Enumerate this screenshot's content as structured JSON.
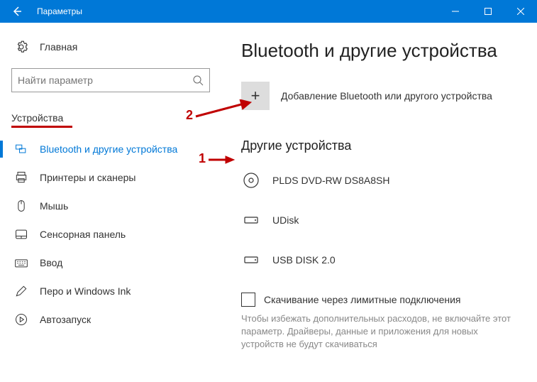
{
  "titlebar": {
    "title": "Параметры"
  },
  "sidebar": {
    "home_label": "Главная",
    "search_placeholder": "Найти параметр",
    "section": "Устройства",
    "items": [
      {
        "label": "Bluetooth и другие устройства"
      },
      {
        "label": "Принтеры и сканеры"
      },
      {
        "label": "Мышь"
      },
      {
        "label": "Сенсорная панель"
      },
      {
        "label": "Ввод"
      },
      {
        "label": "Перо и Windows Ink"
      },
      {
        "label": "Автозапуск"
      }
    ]
  },
  "main": {
    "title": "Bluetooth и другие устройства",
    "add_label": "Добавление Bluetooth или другого устройства",
    "other_devices": "Другие устройства",
    "devices": [
      {
        "label": "PLDS DVD-RW DS8A8SH"
      },
      {
        "label": "UDisk"
      },
      {
        "label": "USB DISK 2.0"
      }
    ],
    "metered_label": "Скачивание через лимитные подключения",
    "metered_hint": "Чтобы избежать дополнительных расходов, не включайте этот параметр. Драйверы, данные и приложения для новых устройств не будут скачиваться"
  },
  "annotations": {
    "one": "1",
    "two": "2"
  }
}
